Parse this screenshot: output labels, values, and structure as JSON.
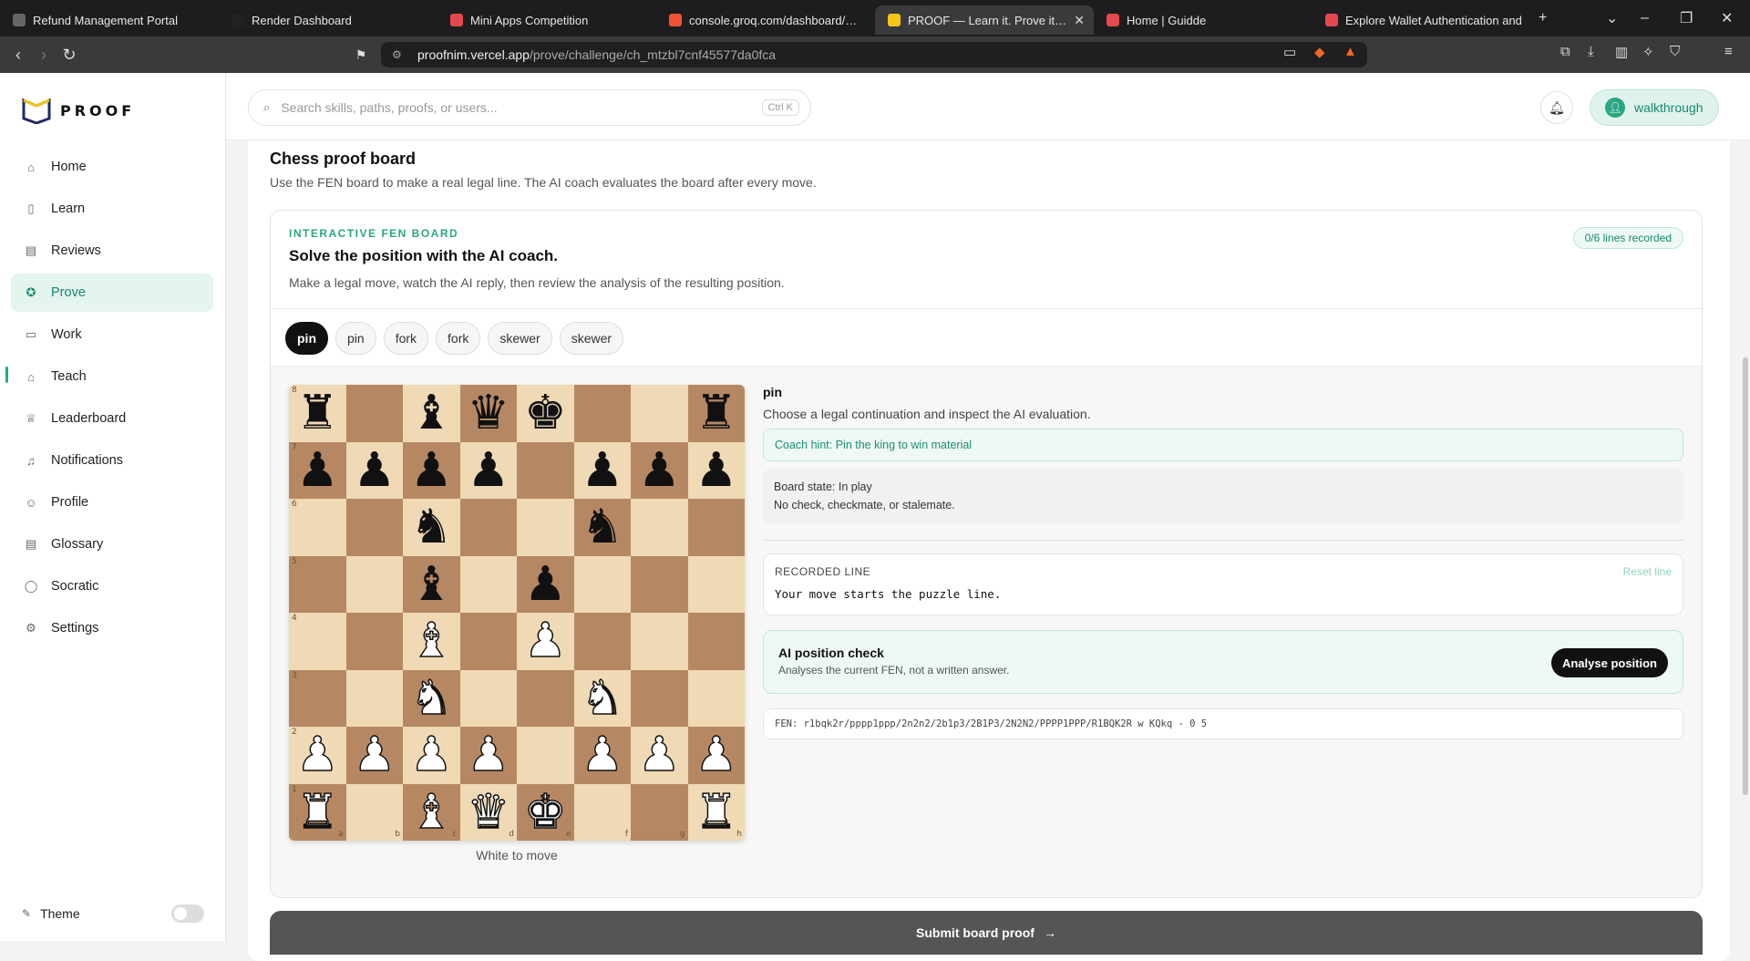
{
  "browser": {
    "tabs": [
      {
        "title": "Refund Management Portal",
        "favicon": "globe-icon",
        "color": "#666666"
      },
      {
        "title": "Render Dashboard",
        "favicon": "render-icon",
        "color": "#222222"
      },
      {
        "title": "Mini Apps Competition",
        "favicon": "sk-icon",
        "color": "#e5484d"
      },
      {
        "title": "console.groq.com/dashboard/metric",
        "favicon": "groq-icon",
        "color": "#f55036"
      },
      {
        "title": "PROOF — Learn it. Prove it. Earn",
        "favicon": "proof-icon",
        "color": "#f5c518",
        "active": true
      },
      {
        "title": "Home | Guidde",
        "favicon": "guidde-icon",
        "color": "#e5484d"
      },
      {
        "title": "Explore Wallet Authentication and",
        "favicon": "guidde-icon",
        "color": "#e5484d"
      }
    ],
    "url_host": "proofnim.vercel.app",
    "url_path": "/prove/challenge/ch_mtzbl7cnf45577da0fca"
  },
  "app": {
    "brand": "PROOF",
    "nav": [
      {
        "label": "Home",
        "icon": "home-icon"
      },
      {
        "label": "Learn",
        "icon": "book-icon"
      },
      {
        "label": "Reviews",
        "icon": "clipboard-icon"
      },
      {
        "label": "Prove",
        "icon": "award-icon",
        "active": true
      },
      {
        "label": "Work",
        "icon": "briefcase-icon"
      },
      {
        "label": "Teach",
        "icon": "graduation-cap-icon"
      },
      {
        "label": "Leaderboard",
        "icon": "trophy-icon"
      },
      {
        "label": "Notifications",
        "icon": "bell-icon"
      },
      {
        "label": "Profile",
        "icon": "user-icon"
      },
      {
        "label": "Glossary",
        "icon": "book-open-icon"
      },
      {
        "label": "Socratic",
        "icon": "chat-icon"
      },
      {
        "label": "Settings",
        "icon": "gear-icon"
      }
    ],
    "theme_label": "Theme",
    "search_placeholder": "Search skills, paths, proofs, or users...",
    "search_shortcut": "Ctrl K",
    "user_name": "walkthrough",
    "accent": "#2aa785"
  },
  "page": {
    "title": "Chess proof board",
    "subtitle": "Use the FEN board to make a real legal line. The AI coach evaluates the board after every move.",
    "card": {
      "eyebrow": "INTERACTIVE FEN BOARD",
      "title": "Solve the position with the AI coach.",
      "desc": "Make a legal move, watch the AI reply, then review the analysis of the resulting position.",
      "lines_badge": "0/6 lines recorded"
    },
    "chips": [
      "pin",
      "pin",
      "fork",
      "fork",
      "skewer",
      "skewer"
    ],
    "active_chip": 0,
    "to_move": "White to move",
    "puzzle": {
      "title": "pin",
      "desc": "Choose a legal continuation and inspect the AI evaluation.",
      "hint": "Coach hint: Pin the king to win material",
      "board_state": "Board state: In play",
      "board_state_detail": "No check, checkmate, or stalemate.",
      "recorded_label": "RECORDED LINE",
      "reset_label": "Reset line",
      "recorded_text": "Your move starts the puzzle line.",
      "ai_title": "AI position check",
      "ai_sub": "Analyses the current FEN, not a written answer.",
      "ai_button": "Analyse position",
      "fen": "FEN: r1bqk2r/pppp1ppp/2n2n2/2b1p3/2B1P3/2N2N2/PPPP1PPP/R1BQK2R w KQkq - 0 5"
    },
    "board_fen": "r1bqk2r/pppp1ppp/2n2n2/2b1p3/2B1P3/2N2N2/PPPP1PPP/R1BQK2R",
    "submit_label": "Submit board proof"
  }
}
